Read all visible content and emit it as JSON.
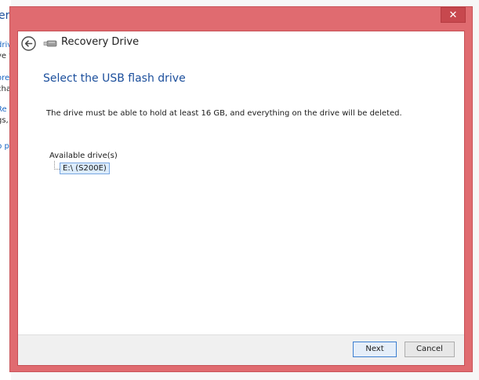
{
  "background_window": {
    "title_fragment": "ery",
    "lines": [
      {
        "text": "driv",
        "link": true
      },
      {
        "text": "ve tl",
        "link": false
      },
      {
        "text": "ore",
        "link": true
      },
      {
        "text": "cha",
        "link": false
      },
      {
        "text": "Re",
        "link": true
      },
      {
        "text": "gs,",
        "link": false
      },
      {
        "text": "p pr",
        "link": true
      }
    ]
  },
  "window": {
    "close_glyph": "✕",
    "app_title": "Recovery Drive",
    "heading": "Select the USB flash drive",
    "description": "The drive must be able to hold at least 16 GB, and everything on the drive will be deleted.",
    "available_label": "Available drive(s)",
    "drives": [
      "E:\\ (S200E)"
    ],
    "buttons": {
      "next": "Next",
      "cancel": "Cancel"
    },
    "icons": {
      "back": "back-arrow-icon",
      "usb": "usb-drive-icon",
      "close": "close-icon"
    },
    "colors": {
      "frame": "#e06b70",
      "heading": "#1c4f9c",
      "selection": "#dcecfc"
    }
  }
}
